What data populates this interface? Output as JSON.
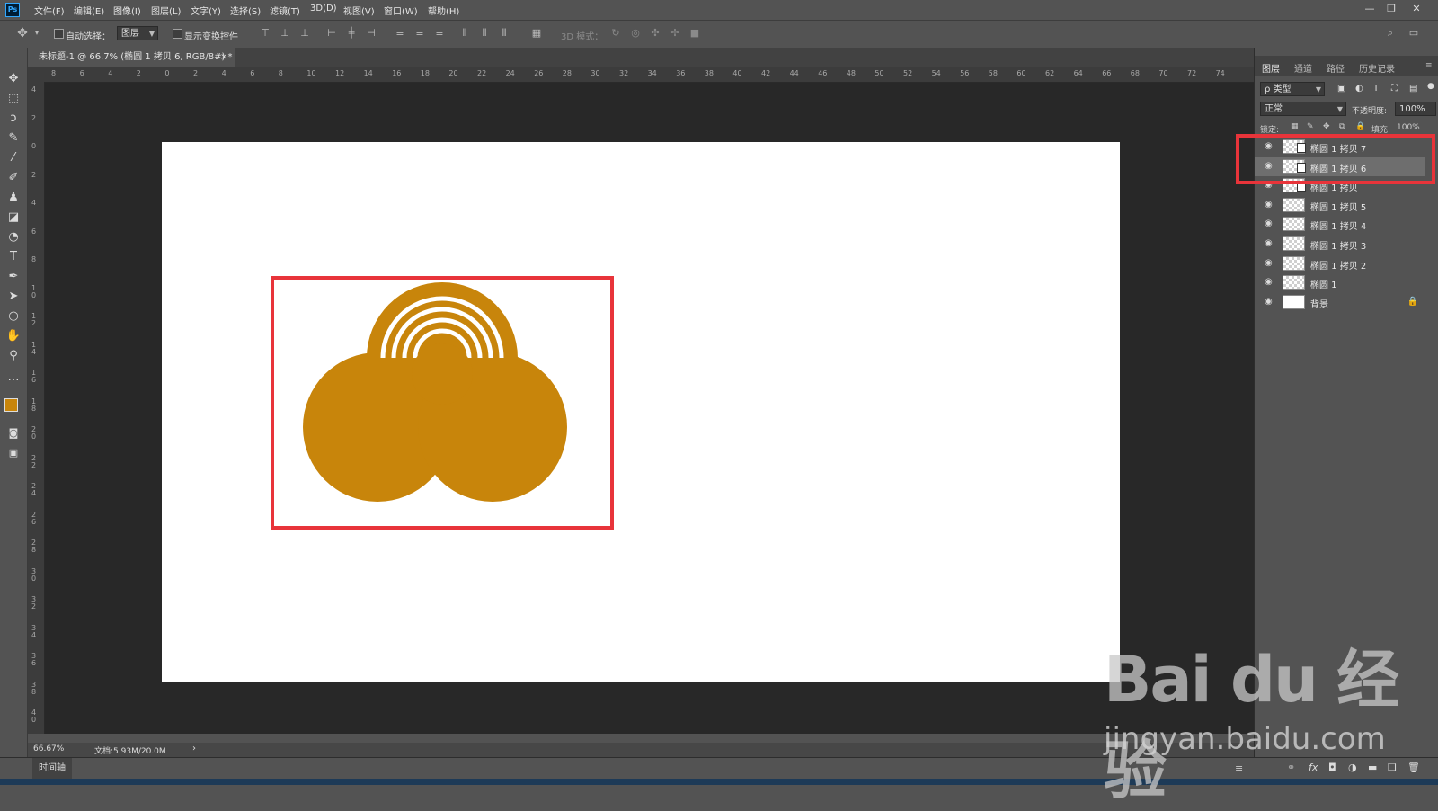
{
  "app": {
    "logo_text": "Ps",
    "menu": [
      "文件(F)",
      "编辑(E)",
      "图像(I)",
      "图层(L)",
      "文字(Y)",
      "选择(S)",
      "滤镜(T)",
      "3D(D)",
      "视图(V)",
      "窗口(W)",
      "帮助(H)"
    ],
    "window_buttons": [
      "—",
      "❐",
      "✕"
    ]
  },
  "options_bar": {
    "auto_select_label": "自动选择：",
    "auto_select_value": "图层",
    "show_transform_label": "显示变换控件",
    "mode_3d_label": "3D 模式："
  },
  "document": {
    "tab_title": "未标题-1 @ 66.7% (椭圆 1 拷贝 6, RGB/8#) *",
    "tab_close": "×",
    "shape_color": "#c8850b",
    "highlight_color": "#e8343a"
  },
  "rulers": {
    "h_ticks": [
      "8",
      "6",
      "4",
      "2",
      "0",
      "2",
      "4",
      "6",
      "8",
      "10",
      "12",
      "14",
      "16",
      "18",
      "20",
      "22",
      "24",
      "26",
      "28",
      "30",
      "32",
      "34",
      "36",
      "38",
      "40",
      "42",
      "44",
      "46",
      "48",
      "50",
      "52",
      "54",
      "56",
      "58",
      "60",
      "62",
      "64",
      "66",
      "68",
      "70",
      "72",
      "74"
    ],
    "v_ticks": [
      "4",
      "2",
      "0",
      "2",
      "4",
      "6",
      "8",
      "1 0",
      "1 2",
      "1 4",
      "1 6",
      "1 8",
      "2 0",
      "2 2",
      "2 4",
      "2 6",
      "2 8",
      "3 0",
      "3 2",
      "3 4",
      "3 6",
      "3 8",
      "4 0"
    ]
  },
  "status": {
    "zoom": "66.67%",
    "doc_size": "文档:5.93M/20.0M",
    "arrow": "›"
  },
  "timeline": {
    "label": "时间轴"
  },
  "panel": {
    "tabs": [
      "图层",
      "通道",
      "路径",
      "历史记录"
    ],
    "filter_label": "ρ 类型",
    "blend_mode": "正常",
    "opacity_label": "不透明度:",
    "opacity_value": "100%",
    "lock_label": "锁定:",
    "fill_label": "填充:",
    "fill_value": "100%",
    "layers": [
      {
        "name": "椭圆 1 拷贝 7",
        "selected": false,
        "kind": "smart"
      },
      {
        "name": "椭圆 1 拷贝 6",
        "selected": true,
        "kind": "smart"
      },
      {
        "name": "椭圆 1 拷贝",
        "selected": false,
        "kind": "smart"
      },
      {
        "name": "椭圆 1 拷贝 5",
        "selected": false,
        "kind": "shape"
      },
      {
        "name": "椭圆 1 拷贝 4",
        "selected": false,
        "kind": "shape"
      },
      {
        "name": "椭圆 1 拷贝 3",
        "selected": false,
        "kind": "shape"
      },
      {
        "name": "椭圆 1 拷贝 2",
        "selected": false,
        "kind": "shape"
      },
      {
        "name": "椭圆 1",
        "selected": false,
        "kind": "shape"
      },
      {
        "name": "背景",
        "selected": false,
        "kind": "background"
      }
    ]
  },
  "watermark": {
    "brand": "Bai du 经验",
    "url": "jingyan.baidu.com"
  }
}
